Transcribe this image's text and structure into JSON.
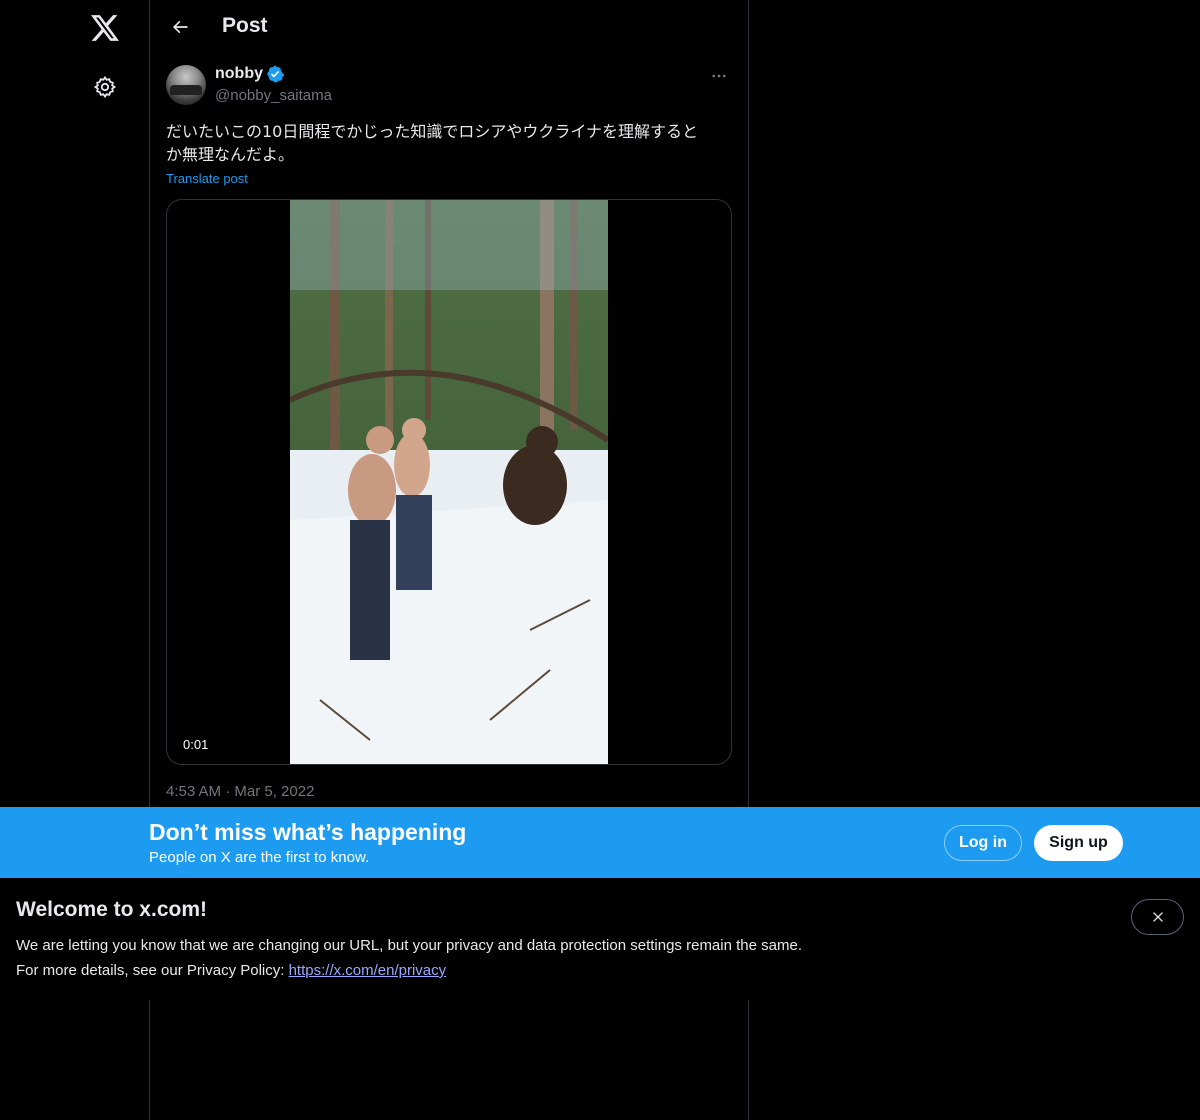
{
  "header": {
    "title": "Post"
  },
  "icons": {
    "logo": "x-logo-icon",
    "settings": "gear-icon",
    "back": "arrow-left-icon",
    "more": "more-horizontal-icon",
    "verified": "verified-badge-icon",
    "close": "close-icon"
  },
  "post": {
    "author_name": "nobby",
    "author_handle": "@nobby_saitama",
    "text_line1": "だいたいこの10日間程でかじった知識でロシアやウクライナを理解すると",
    "text_line2": "か無理なんだよ。",
    "translate_label": "Translate post",
    "video_timecode": "0:01",
    "timestamp": "4:53 AM · Mar 5, 2022"
  },
  "banner": {
    "title": "Don’t miss what’s happening",
    "subtitle": "People on X are the first to know.",
    "login_label": "Log in",
    "signup_label": "Sign up"
  },
  "notice": {
    "title": "Welcome to x.com!",
    "line1": "We are letting you know that we are changing our URL, but your privacy and data protection settings remain the same.",
    "line2_prefix": "For more details, see our Privacy Policy: ",
    "link_text": "https://x.com/en/privacy"
  },
  "colors": {
    "accent": "#1d9bf0",
    "background": "#000000",
    "muted_text": "#71767b",
    "border": "#2f3336"
  }
}
